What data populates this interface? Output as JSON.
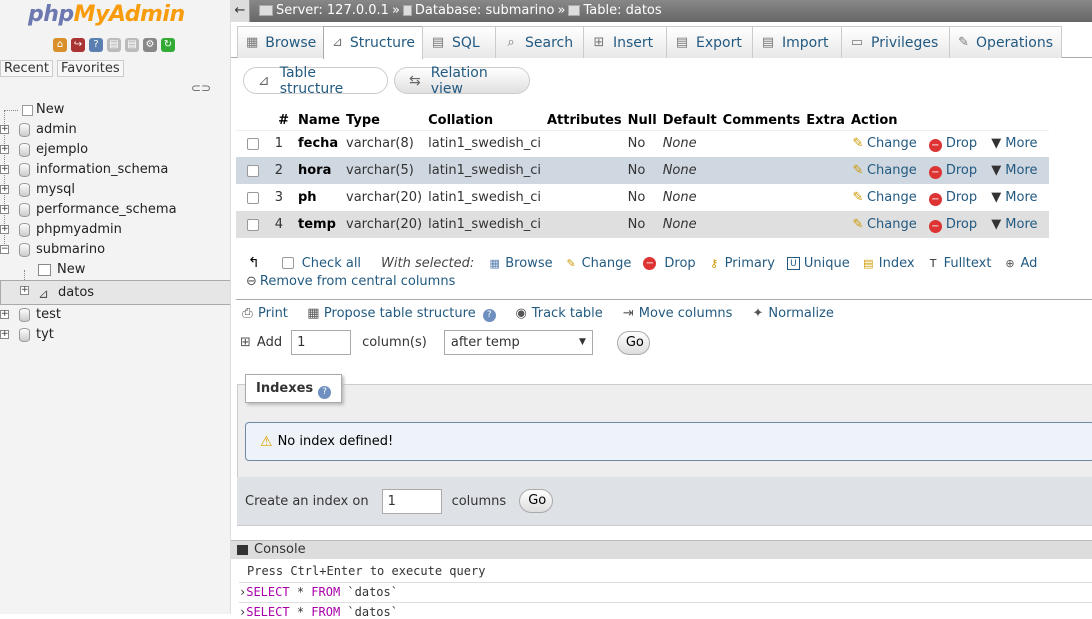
{
  "sidebar": {
    "logo_php": "php",
    "logo_myadmin": "MyAdmin",
    "recent_label": "Recent",
    "favorites_label": "Favorites",
    "tree": [
      {
        "label": "New",
        "level": 0,
        "kind": "new"
      },
      {
        "label": "admin",
        "level": 0,
        "kind": "db"
      },
      {
        "label": "ejemplo",
        "level": 0,
        "kind": "db"
      },
      {
        "label": "information_schema",
        "level": 0,
        "kind": "db"
      },
      {
        "label": "mysql",
        "level": 0,
        "kind": "db"
      },
      {
        "label": "performance_schema",
        "level": 0,
        "kind": "db"
      },
      {
        "label": "phpmyadmin",
        "level": 0,
        "kind": "db"
      },
      {
        "label": "submarino",
        "level": 0,
        "kind": "db-open"
      },
      {
        "label": "New",
        "level": 1,
        "kind": "new"
      },
      {
        "label": "datos",
        "level": 1,
        "kind": "table"
      },
      {
        "label": "test",
        "level": 0,
        "kind": "db"
      },
      {
        "label": "tyt",
        "level": 0,
        "kind": "db"
      }
    ]
  },
  "breadcrumb": {
    "server": "Server: 127.0.0.1",
    "database": "Database: submarino",
    "table": "Table: datos",
    "sep": "»"
  },
  "tabs": [
    {
      "label": "Browse",
      "icon": "browse-icon"
    },
    {
      "label": "Structure",
      "icon": "structure-icon",
      "active": true
    },
    {
      "label": "SQL",
      "icon": "sql-icon"
    },
    {
      "label": "Search",
      "icon": "search-icon"
    },
    {
      "label": "Insert",
      "icon": "insert-icon"
    },
    {
      "label": "Export",
      "icon": "export-icon"
    },
    {
      "label": "Import",
      "icon": "import-icon"
    },
    {
      "label": "Privileges",
      "icon": "privileges-icon"
    },
    {
      "label": "Operations",
      "icon": "operations-icon"
    }
  ],
  "subtabs": {
    "structure": "Table structure",
    "relation": "Relation view"
  },
  "columns_table": {
    "headers": [
      "#",
      "Name",
      "Type",
      "Collation",
      "Attributes",
      "Null",
      "Default",
      "Comments",
      "Extra",
      "Action"
    ],
    "rows": [
      {
        "num": "1",
        "name": "fecha",
        "type": "varchar(8)",
        "collation": "latin1_swedish_ci",
        "attributes": "",
        "null": "No",
        "default": "None",
        "comments": "",
        "extra": ""
      },
      {
        "num": "2",
        "name": "hora",
        "type": "varchar(5)",
        "collation": "latin1_swedish_ci",
        "attributes": "",
        "null": "No",
        "default": "None",
        "comments": "",
        "extra": ""
      },
      {
        "num": "3",
        "name": "ph",
        "type": "varchar(20)",
        "collation": "latin1_swedish_ci",
        "attributes": "",
        "null": "No",
        "default": "None",
        "comments": "",
        "extra": ""
      },
      {
        "num": "4",
        "name": "temp",
        "type": "varchar(20)",
        "collation": "latin1_swedish_ci",
        "attributes": "",
        "null": "No",
        "default": "None",
        "comments": "",
        "extra": ""
      }
    ],
    "action_change": "Change",
    "action_drop": "Drop",
    "action_more": "More"
  },
  "bulk": {
    "check_all": "Check all",
    "with_selected": "With selected:",
    "browse": "Browse",
    "change": "Change",
    "drop": "Drop",
    "primary": "Primary",
    "unique": "Unique",
    "index": "Index",
    "fulltext": "Fulltext",
    "add_cut": "Ad",
    "remove_central": "Remove from central columns"
  },
  "tools": {
    "print": "Print",
    "propose": "Propose table structure",
    "track": "Track table",
    "move": "Move columns",
    "normalize": "Normalize"
  },
  "add_columns": {
    "label": "Add",
    "value": "1",
    "unit": "column(s)",
    "position": "after temp",
    "go": "Go"
  },
  "indexes": {
    "legend": "Indexes",
    "notice": "No index defined!",
    "create_label": "Create an index on",
    "create_value": "1",
    "create_unit": "columns",
    "go": "Go"
  },
  "console": {
    "title": "Console",
    "hint": "Press Ctrl+Enter to execute query",
    "q1_kw1": "SELECT",
    "q1_mid": " * ",
    "q1_kw2": "FROM",
    "q1_tail": " `datos`",
    "q2_kw1": "SELECT",
    "q2_mid": " * ",
    "q2_kw2": "FROM",
    "q2_tail": " `datos`"
  }
}
